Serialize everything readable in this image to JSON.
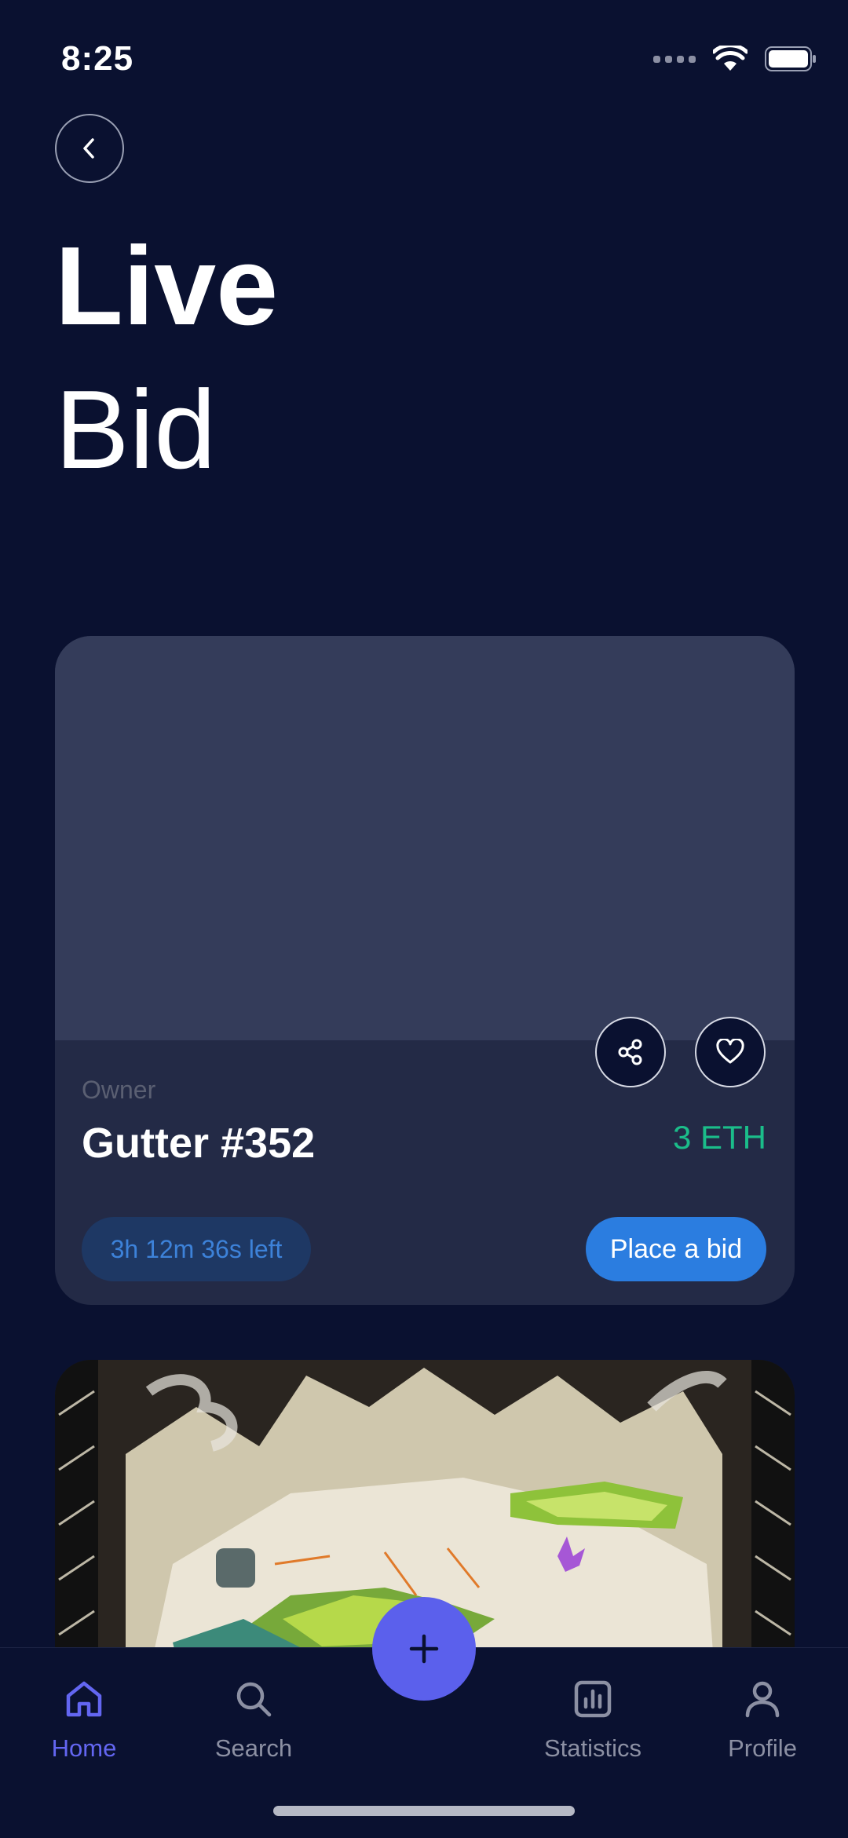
{
  "status_bar": {
    "time": "8:25"
  },
  "header": {
    "title_line1": "Live",
    "title_line2": "Bid"
  },
  "card": {
    "owner_label": "Owner",
    "item_name": "Gutter #352",
    "price": "3 ETH",
    "time_left": "3h 12m 36s left",
    "bid_button": "Place a bid"
  },
  "tabbar": {
    "items": [
      {
        "label": "Home",
        "icon": "home-icon",
        "active": true
      },
      {
        "label": "Search",
        "icon": "search-icon"
      },
      {
        "label": "Statistics",
        "icon": "bar-chart-icon"
      },
      {
        "label": "Profile",
        "icon": "user-icon"
      }
    ],
    "fab_icon": "plus-icon"
  },
  "colors": {
    "background": "#0a1130",
    "accent": "#6366f1",
    "price": "#1bbd8a",
    "bid_button": "#2b7de0"
  }
}
